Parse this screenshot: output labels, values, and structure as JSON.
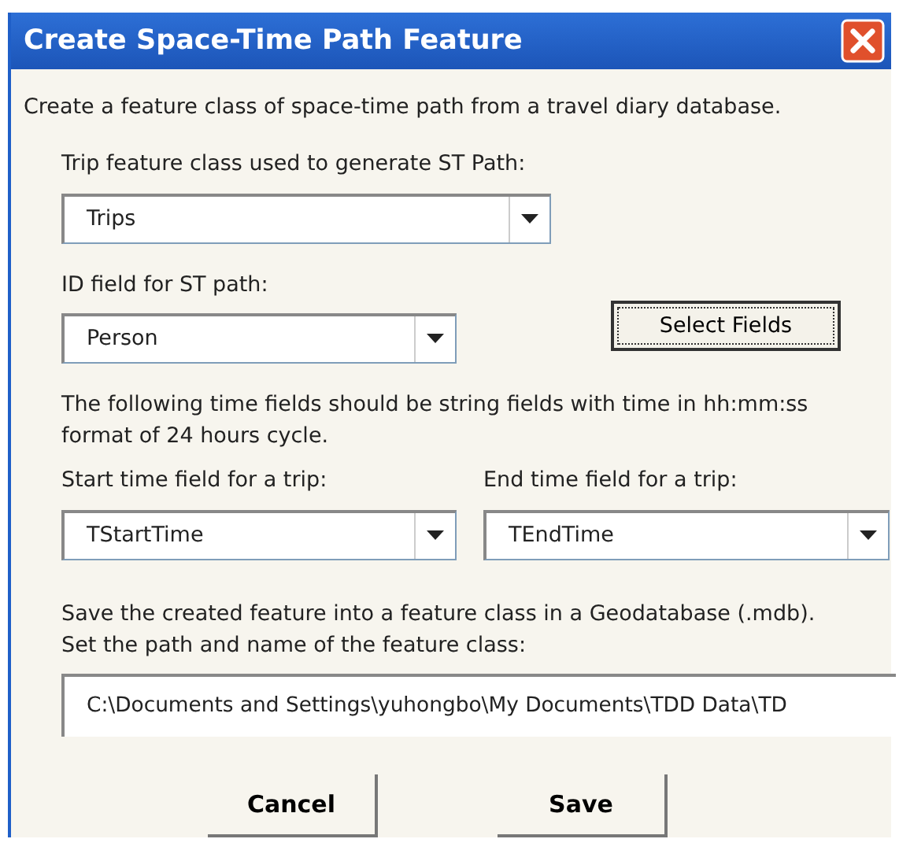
{
  "window": {
    "title": "Create Space-Time Path Feature"
  },
  "description": "Create a feature class of space-time path from a travel diary database.",
  "trip_class": {
    "label": "Trip feature class used to generate ST Path:",
    "value": "Trips"
  },
  "id_field": {
    "label": "ID field for ST path:",
    "value": "Person"
  },
  "select_fields_button": {
    "label": "Select Fields",
    "focused": true
  },
  "time_note": "The following time fields should be string fields with time in hh:mm:ss format of 24 hours cycle.",
  "start_time": {
    "label": "Start time field for a trip:",
    "value": "TStartTime"
  },
  "end_time": {
    "label": "End time field for a trip:",
    "value": "TEndTime"
  },
  "save_note": [
    "Save the created feature into a feature class in a Geodatabase (.mdb).",
    "Set the path and name of the feature class:"
  ],
  "output_path": {
    "value": "C:\\Documents and Settings\\yuhongbo\\My Documents\\TDD Data\\TD"
  },
  "buttons": [
    {
      "label": "Cancel"
    },
    {
      "label": "Save"
    }
  ]
}
